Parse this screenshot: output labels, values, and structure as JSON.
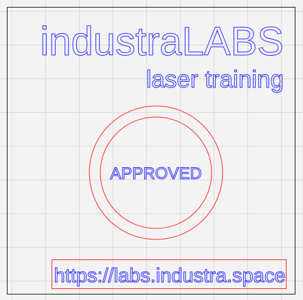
{
  "design": {
    "brand": {
      "name_lower": "industra",
      "name_upper": "LABS"
    },
    "subtitle": "laser training",
    "stamp": {
      "text": "APPROVED"
    },
    "url": "https://labs.industra.space"
  },
  "colors": {
    "cut_line": "#ff2a2a",
    "engrave_text": "#2b2bff",
    "frame": "#222222",
    "grid": "#dcdcdc",
    "background": "#f3f3f3"
  }
}
